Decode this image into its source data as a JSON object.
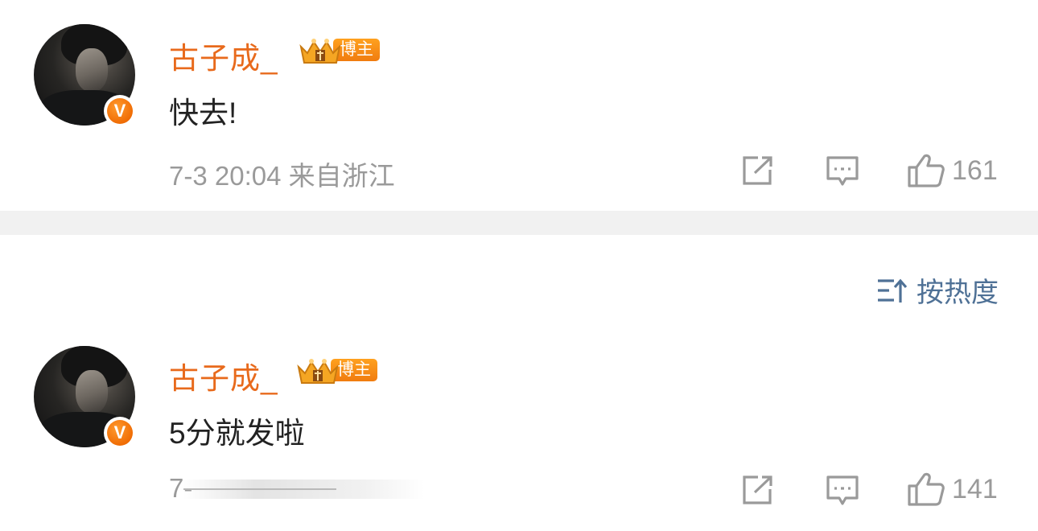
{
  "comments": [
    {
      "username": "古子成_",
      "badge_label": "博主",
      "text": "快去!",
      "meta": "7-3 20:04 来自浙江",
      "likes": "161"
    },
    {
      "username": "古子成_",
      "badge_label": "博主",
      "text": "5分就发啦",
      "meta": "7-",
      "likes": "141"
    }
  ],
  "sort": {
    "label": "按热度"
  },
  "icons": {
    "share": "share-icon",
    "comment": "comment-icon",
    "like": "thumbs-up-icon",
    "verified": "verified-v-icon",
    "crown": "crown-icon",
    "sort": "sort-icon"
  },
  "colors": {
    "username": "#e86a1c",
    "meta": "#9a9a9a",
    "sort": "#4f7196",
    "verified": "#f06d05",
    "divider": "#f1f1f1"
  }
}
